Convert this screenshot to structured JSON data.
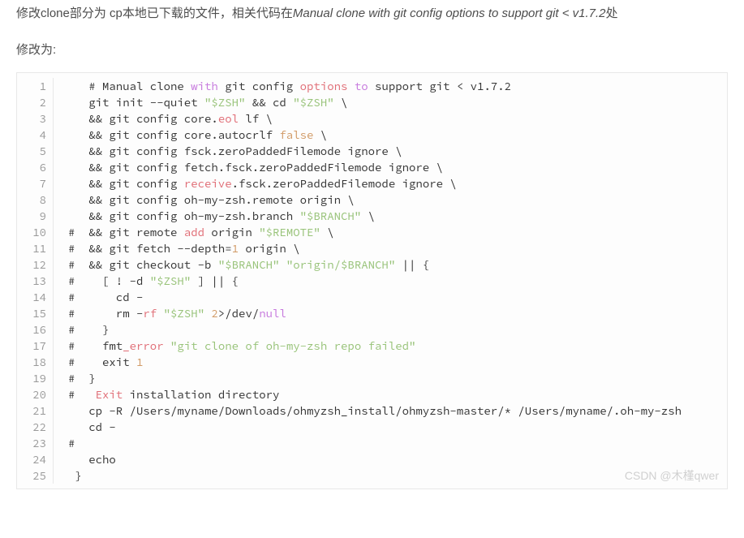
{
  "intro": {
    "prefix": "修改clone部分为 cp本地已下载的文件，相关代码在",
    "italic": "Manual clone with git config options to support git < v1.7.2",
    "suffix": "处"
  },
  "modify_label": "修改为:",
  "code": {
    "lines": [
      {
        "n": "1",
        "tokens": [
          {
            "t": "   # Manual clone "
          },
          {
            "t": "with",
            "c": "kw"
          },
          {
            "t": " git config "
          },
          {
            "t": "options",
            "c": "ident"
          },
          {
            "t": " "
          },
          {
            "t": "to",
            "c": "kw"
          },
          {
            "t": " support git < v1.7.2"
          }
        ]
      },
      {
        "n": "2",
        "tokens": [
          {
            "t": "   git init --quiet "
          },
          {
            "t": "\"$ZSH\"",
            "c": "str"
          },
          {
            "t": " && cd "
          },
          {
            "t": "\"$ZSH\"",
            "c": "str"
          },
          {
            "t": " \\"
          }
        ]
      },
      {
        "n": "3",
        "tokens": [
          {
            "t": "   && git config core."
          },
          {
            "t": "eol",
            "c": "ident"
          },
          {
            "t": " lf \\"
          }
        ]
      },
      {
        "n": "4",
        "tokens": [
          {
            "t": "   && git config core.autocrlf "
          },
          {
            "t": "false",
            "c": "bool"
          },
          {
            "t": " \\"
          }
        ]
      },
      {
        "n": "5",
        "tokens": [
          {
            "t": "   && git config fsck.zeroPaddedFilemode ignore \\"
          }
        ]
      },
      {
        "n": "6",
        "tokens": [
          {
            "t": "   && git config fetch.fsck.zeroPaddedFilemode ignore \\"
          }
        ]
      },
      {
        "n": "7",
        "tokens": [
          {
            "t": "   && git config "
          },
          {
            "t": "receive",
            "c": "ident"
          },
          {
            "t": ".fsck.zeroPaddedFilemode ignore \\"
          }
        ]
      },
      {
        "n": "8",
        "tokens": [
          {
            "t": "   && git config oh-my-zsh.remote origin \\"
          }
        ]
      },
      {
        "n": "9",
        "tokens": [
          {
            "t": "   && git config oh-my-zsh.branch "
          },
          {
            "t": "\"$BRANCH\"",
            "c": "str"
          },
          {
            "t": " \\"
          }
        ]
      },
      {
        "n": "10",
        "tokens": [
          {
            "t": "#  && git remote "
          },
          {
            "t": "add",
            "c": "ident"
          },
          {
            "t": " origin "
          },
          {
            "t": "\"$REMOTE\"",
            "c": "str"
          },
          {
            "t": " \\"
          }
        ]
      },
      {
        "n": "11",
        "tokens": [
          {
            "t": "#  && git fetch --depth="
          },
          {
            "t": "1",
            "c": "num"
          },
          {
            "t": " origin \\"
          }
        ]
      },
      {
        "n": "12",
        "tokens": [
          {
            "t": "#  && git checkout -b "
          },
          {
            "t": "\"$BRANCH\"",
            "c": "str"
          },
          {
            "t": " "
          },
          {
            "t": "\"origin/$BRANCH\"",
            "c": "str"
          },
          {
            "t": " || {"
          }
        ]
      },
      {
        "n": "13",
        "tokens": [
          {
            "t": "#    [ ! -d "
          },
          {
            "t": "\"$ZSH\"",
            "c": "str"
          },
          {
            "t": " ] || {"
          }
        ]
      },
      {
        "n": "14",
        "tokens": [
          {
            "t": "#      cd -"
          }
        ]
      },
      {
        "n": "15",
        "tokens": [
          {
            "t": "#      rm -"
          },
          {
            "t": "rf",
            "c": "ident"
          },
          {
            "t": " "
          },
          {
            "t": "\"$ZSH\"",
            "c": "str"
          },
          {
            "t": " "
          },
          {
            "t": "2",
            "c": "num"
          },
          {
            "t": ">/dev/"
          },
          {
            "t": "null",
            "c": "null"
          }
        ]
      },
      {
        "n": "16",
        "tokens": [
          {
            "t": "#    }"
          }
        ]
      },
      {
        "n": "17",
        "tokens": [
          {
            "t": "#    fmt"
          },
          {
            "t": "_",
            "c": "ident"
          },
          {
            "t": "error",
            "c": "ident"
          },
          {
            "t": " "
          },
          {
            "t": "\"git clone of oh-my-zsh repo failed\"",
            "c": "str"
          }
        ]
      },
      {
        "n": "18",
        "tokens": [
          {
            "t": "#    exit "
          },
          {
            "t": "1",
            "c": "num"
          }
        ]
      },
      {
        "n": "19",
        "tokens": [
          {
            "t": "#  }"
          }
        ]
      },
      {
        "n": "20",
        "tokens": [
          {
            "t": "#   "
          },
          {
            "t": "Exit",
            "c": "ident"
          },
          {
            "t": " installation directory"
          }
        ]
      },
      {
        "n": "21",
        "tokens": [
          {
            "t": "   cp -R /Users/myname/Downloads/ohmyzsh_install/ohmyzsh-master/* /Users/myname/.oh-my-zsh"
          }
        ]
      },
      {
        "n": "22",
        "tokens": [
          {
            "t": "   cd -"
          }
        ]
      },
      {
        "n": "23",
        "tokens": [
          {
            "t": "#"
          }
        ]
      },
      {
        "n": "24",
        "tokens": [
          {
            "t": "   echo"
          }
        ]
      },
      {
        "n": "25",
        "tokens": [
          {
            "t": " }"
          }
        ]
      }
    ]
  },
  "watermark": "CSDN @木槿qwer"
}
